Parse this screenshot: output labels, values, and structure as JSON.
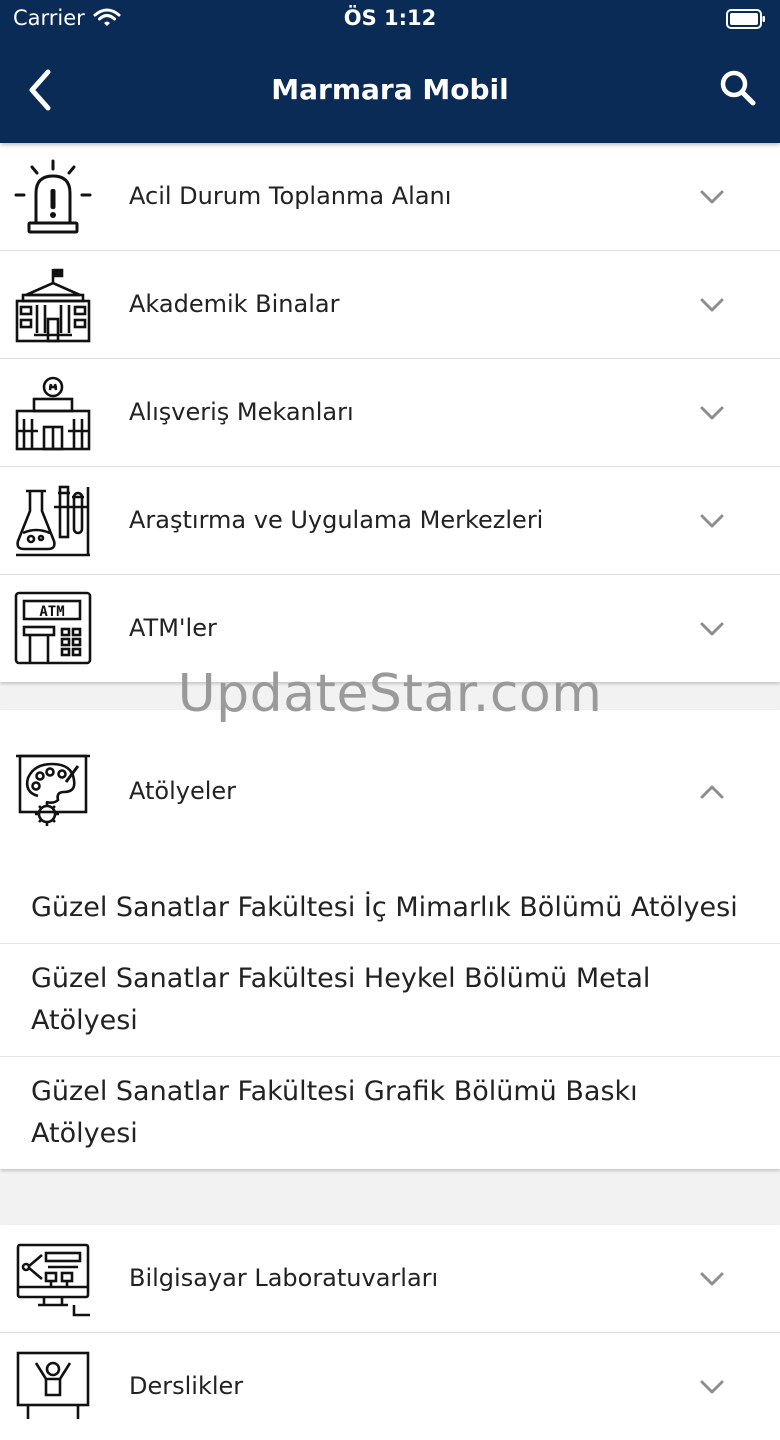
{
  "status_bar": {
    "carrier": "Carrier",
    "time": "ÖS 1:12"
  },
  "nav": {
    "title": "Marmara Mobil",
    "back_icon": "chevron-left-icon",
    "search_icon": "search-icon"
  },
  "categories": [
    {
      "label": "Acil Durum Toplanma Alanı",
      "icon": "alarm-siren-icon"
    },
    {
      "label": "Akademik Binalar",
      "icon": "university-building-icon"
    },
    {
      "label": "Alışveriş Mekanları",
      "icon": "shopping-mall-icon"
    },
    {
      "label": "Araştırma ve Uygulama Merkezleri",
      "icon": "laboratory-flask-icon"
    },
    {
      "label": "ATM'ler",
      "icon": "atm-icon",
      "atm_text": "ATM"
    }
  ],
  "watermark": "UpdateStar.com",
  "expanded": {
    "label": "Atölyeler",
    "icon": "art-palette-gear-icon",
    "items": [
      "Güzel Sanatlar Fakültesi İç Mimarlık Bölümü Atölyesi",
      "Güzel Sanatlar Fakültesi Heykel Bölümü Metal Atölyesi",
      "Güzel Sanatlar Fakültesi Grafik Bölümü Baskı Atölyesi"
    ]
  },
  "more_categories": [
    {
      "label": "Bilgisayar Laboratuvarları",
      "icon": "computer-lab-icon"
    },
    {
      "label": "Derslikler",
      "icon": "classroom-icon"
    }
  ],
  "colors": {
    "header": "#0b2b57",
    "background": "#f2f2f2",
    "text": "#222222",
    "chevron": "#8e8e8e"
  }
}
